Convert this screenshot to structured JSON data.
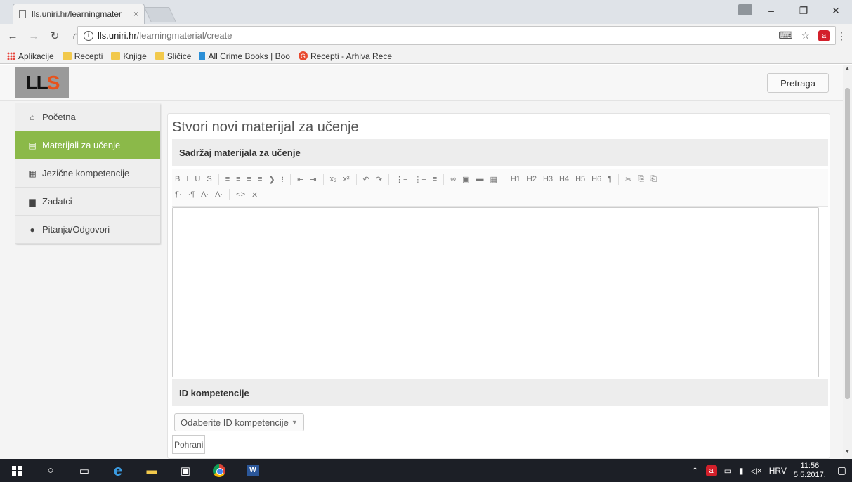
{
  "browser": {
    "tab_title": "lls.uniri.hr/learningmater",
    "tab_close": "×",
    "url_host": "lls.uniri.hr",
    "url_path": "/learningmaterial/create",
    "bookmarks": [
      {
        "label": "Aplikacije",
        "icon": "apps-grid-icon"
      },
      {
        "label": "Recepti",
        "icon": "folder-icon"
      },
      {
        "label": "Knjige",
        "icon": "folder-icon"
      },
      {
        "label": "Sličice",
        "icon": "folder-icon"
      },
      {
        "label": "All Crime Books | Boo",
        "icon": "book-icon"
      },
      {
        "label": "Recepti - Arhiva Rece",
        "icon": "recepti-site-icon"
      }
    ]
  },
  "app": {
    "logo_text_1": "LL",
    "logo_text_2": "S",
    "search_label": "Pretraga"
  },
  "sidebar": {
    "items": [
      {
        "label": "Početna",
        "icon": "home-icon",
        "active": false
      },
      {
        "label": "Materijali za učenje",
        "icon": "book-icon",
        "active": true
      },
      {
        "label": "Jezične kompetencije",
        "icon": "calendar-icon",
        "active": false
      },
      {
        "label": "Zadatci",
        "icon": "briefcase-icon",
        "active": false
      },
      {
        "label": "Pitanja/Odgovori",
        "icon": "comment-icon",
        "active": false
      }
    ]
  },
  "main": {
    "page_title": "Stvori novi materijal za učenje",
    "content_section_title": "Sadržaj materijala za učenje",
    "competence_section_title": "ID kompetencije",
    "competence_dropdown_label": "Odaberite ID kompetencije",
    "save_label": "Pohrani"
  },
  "editor_toolbar": {
    "row1": [
      "B",
      "I",
      "U",
      "S",
      "|",
      "≡",
      "≡",
      "≡",
      "≡",
      "❯",
      "⁝",
      "|",
      "⇤",
      "⇥",
      "|",
      "x₂",
      "x²",
      "|",
      "↶",
      "↷",
      "|",
      "⋮≡",
      "⋮≡",
      "≡",
      "|",
      "∞",
      "▣",
      "▬",
      "▦",
      "|",
      "H1",
      "H2",
      "H3",
      "H4",
      "H5",
      "H6",
      "¶",
      "|",
      "✂",
      "⎘",
      "⎗"
    ],
    "row2": [
      "¶·",
      "·¶",
      "A·",
      "A·",
      "|",
      "<>",
      "✕"
    ]
  },
  "taskbar": {
    "language": "HRV",
    "time": "11:56",
    "date": "5.5.2017."
  },
  "colors": {
    "accent_green": "#8bb949",
    "logo_orange": "#e8521b",
    "taskbar_bg": "#1c1f26"
  }
}
